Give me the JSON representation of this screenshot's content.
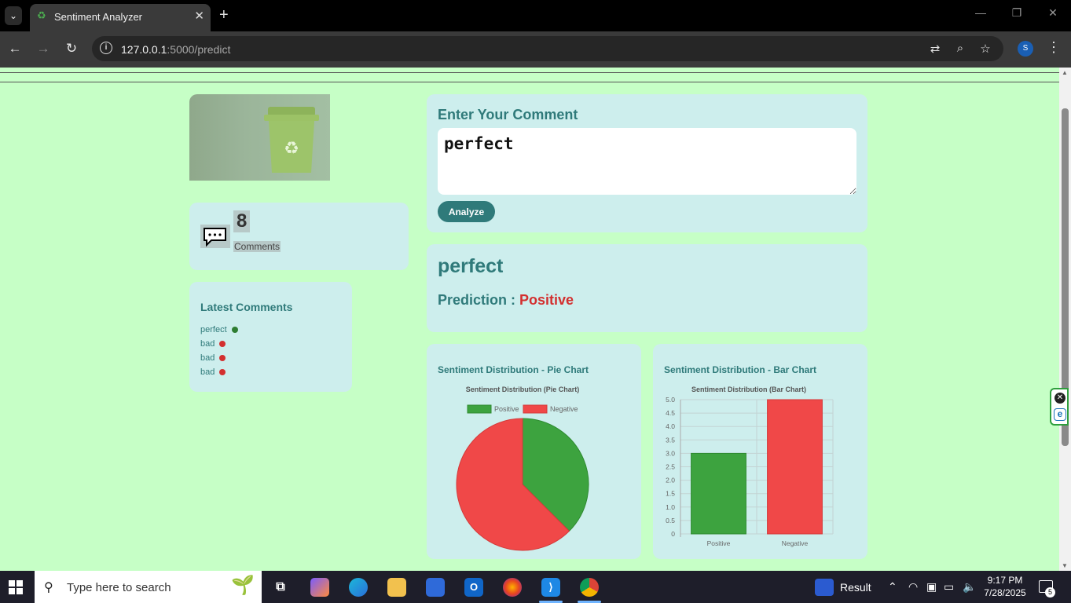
{
  "browser": {
    "tab_title": "Sentiment Analyzer",
    "new_tab_label": "+",
    "url_host": "127.0.0.1",
    "url_path": ":5000/predict",
    "profile_initial": "S"
  },
  "stats": {
    "comment_count": "8",
    "comment_label": "Comments"
  },
  "latest": {
    "title": "Latest Comments",
    "items": [
      {
        "text": "perfect",
        "sentiment": "positive"
      },
      {
        "text": "bad",
        "sentiment": "negative"
      },
      {
        "text": "bad",
        "sentiment": "negative"
      },
      {
        "text": "bad",
        "sentiment": "negative"
      }
    ]
  },
  "form": {
    "title": "Enter Your Comment",
    "comment_value": "perfect",
    "analyze_label": "Analyze"
  },
  "result": {
    "text": "perfect",
    "prediction_label": "Prediction :",
    "prediction_value": "Positive"
  },
  "colors": {
    "positive": "#3da33f",
    "negative": "#f04848",
    "accent": "#2f7a7a",
    "positive_dot": "#2e7d32",
    "negative_dot": "#d32f2f"
  },
  "chart_data": [
    {
      "type": "pie",
      "heading": "Sentiment Distribution - Pie Chart",
      "title": "Sentiment Distribution (Pie Chart)",
      "labels": [
        "Positive",
        "Negative"
      ],
      "values": [
        3,
        5
      ],
      "legend": "top"
    },
    {
      "type": "bar",
      "heading": "Sentiment Distribution - Bar Chart",
      "title": "Sentiment Distribution (Bar Chart)",
      "categories": [
        "Positive",
        "Negative"
      ],
      "values": [
        3,
        5
      ],
      "ylim": [
        0,
        5
      ],
      "yticks": [
        "0",
        "0.5",
        "1.0",
        "1.5",
        "2.0",
        "2.5",
        "3.0",
        "3.5",
        "4.0",
        "4.5",
        "5.0"
      ],
      "grid": true
    }
  ],
  "taskbar": {
    "search_placeholder": "Type here to search",
    "widget_label": "Result",
    "time": "9:17 PM",
    "date": "7/28/2025",
    "notification_count": "5"
  }
}
